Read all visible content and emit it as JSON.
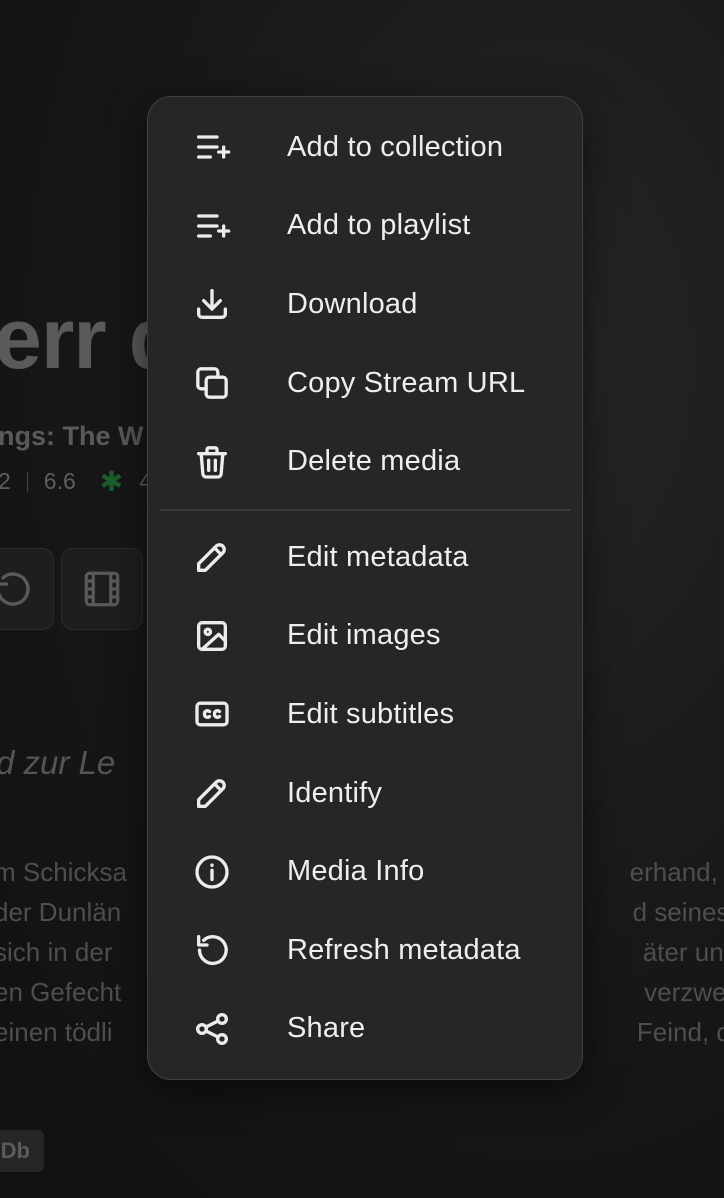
{
  "background": {
    "title": "err d                Die",
    "subtitle": "ngs: The W",
    "meta": {
      "fragment": "2",
      "rating": "6.6",
      "score_fragment": "4"
    },
    "tagline": "d zur Le",
    "overview_lines": [
      {
        "left": "m Schicksa",
        "right": "erhand, de"
      },
      {
        "left": "der Dunlän",
        "right": "d seines V"
      },
      {
        "left": "sich in der",
        "right": "äter unter"
      },
      {
        "left": "en Gefecht",
        "right": "verzweife"
      },
      {
        "left": "einen tödli",
        "right": "Feind, der"
      }
    ],
    "badge": "Db"
  },
  "menu": {
    "groups": [
      [
        {
          "label": "Add to collection",
          "icon": "list-add-icon"
        },
        {
          "label": "Add to playlist",
          "icon": "list-add-icon"
        },
        {
          "label": "Download",
          "icon": "download-icon"
        },
        {
          "label": "Copy Stream URL",
          "icon": "copy-icon"
        },
        {
          "label": "Delete media",
          "icon": "trash-icon"
        }
      ],
      [
        {
          "label": "Edit metadata",
          "icon": "pencil-icon"
        },
        {
          "label": "Edit images",
          "icon": "image-icon"
        },
        {
          "label": "Edit subtitles",
          "icon": "closed-captions-icon"
        },
        {
          "label": "Identify",
          "icon": "pencil-icon"
        },
        {
          "label": "Media Info",
          "icon": "info-icon"
        },
        {
          "label": "Refresh metadata",
          "icon": "refresh-icon"
        },
        {
          "label": "Share",
          "icon": "share-icon"
        }
      ]
    ]
  },
  "colors": {
    "menu_bg": "#262626",
    "menu_border": "#414141",
    "menu_text": "#eeeeee",
    "rating_star": "#1c5e2c"
  }
}
